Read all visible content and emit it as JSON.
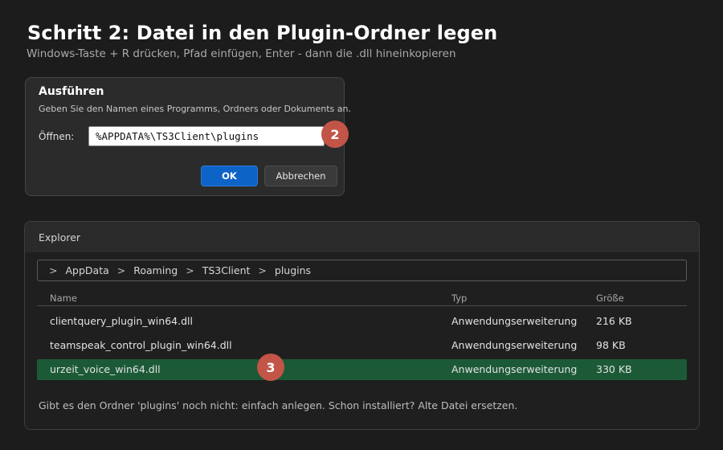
{
  "page": {
    "title": "Schritt 2: Datei in den Plugin-Ordner legen",
    "subtitle": "Windows-Taste + R drücken, Pfad einfügen, Enter  -  dann die .dll hineinkopieren"
  },
  "run_dialog": {
    "title": "Ausführen",
    "description": "Geben Sie den Namen eines Programms, Ordners oder Dokuments an.",
    "open_label": "Öffnen:",
    "open_value": "%APPDATA%\\TS3Client\\plugins",
    "ok_label": "OK",
    "cancel_label": "Abbrechen"
  },
  "markers": {
    "step2": "2",
    "step3": "3"
  },
  "explorer": {
    "title": "Explorer",
    "breadcrumb": [
      "AppData",
      "Roaming",
      "TS3Client",
      "plugins"
    ],
    "breadcrumb_separator": ">",
    "columns": {
      "name": "Name",
      "type": "Typ",
      "size": "Größe"
    },
    "files": [
      {
        "name": "clientquery_plugin_win64.dll",
        "type": "Anwendungserweiterung",
        "size": "216 KB",
        "selected": false
      },
      {
        "name": "teamspeak_control_plugin_win64.dll",
        "type": "Anwendungserweiterung",
        "size": "98 KB",
        "selected": false
      },
      {
        "name": "urzeit_voice_win64.dll",
        "type": "Anwendungserweiterung",
        "size": "330 KB",
        "selected": true
      }
    ],
    "footer_note": "Gibt es den Ordner 'plugins' noch nicht: einfach anlegen. Schon installiert? Alte Datei ersetzen."
  },
  "colors": {
    "accent_button": "#0e63c7",
    "selected_row": "#1c5a37",
    "marker": "#c25548"
  }
}
